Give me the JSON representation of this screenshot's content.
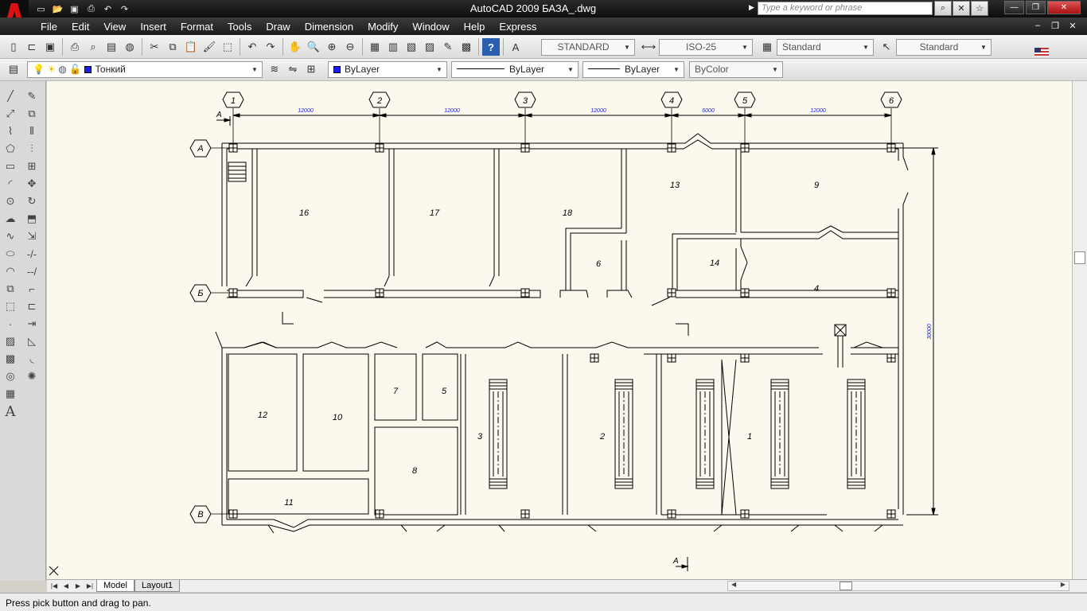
{
  "app": {
    "logo_letter": "A",
    "title": "AutoCAD 2009 БАЗА_.dwg",
    "search_placeholder": "Type a keyword or phrase"
  },
  "menu": [
    "File",
    "Edit",
    "View",
    "Insert",
    "Format",
    "Tools",
    "Draw",
    "Dimension",
    "Modify",
    "Window",
    "Help",
    "Express"
  ],
  "toolbar": {
    "text_style": "STANDARD",
    "dim_style": "ISO-25",
    "table_style": "Standard",
    "multileader_style": "Standard",
    "layer": "Тонкий",
    "color": "ByLayer",
    "linetype": "ByLayer",
    "lineweight": "ByLayer",
    "plot_style": "ByColor"
  },
  "drawing": {
    "axes_columns": [
      "1",
      "2",
      "3",
      "4",
      "5",
      "6"
    ],
    "axes_rows": [
      "А",
      "Б",
      "В"
    ],
    "dims_top": [
      "12000",
      "12000",
      "12000",
      "6000",
      "12000"
    ],
    "dim_right": "30000",
    "section_mark": "А",
    "rooms": [
      "16",
      "17",
      "18",
      "13",
      "9",
      "6",
      "14",
      "4",
      "12",
      "10",
      "7",
      "5",
      "3",
      "2",
      "1",
      "8",
      "11"
    ]
  },
  "tabs": [
    "Model",
    "Layout1"
  ],
  "status": {
    "message": "Press pick button and drag to pan."
  },
  "colors": {
    "canvas": "#fbf9ee",
    "ink": "#000000",
    "dimension_text": "#1a1aff",
    "layer_swatch": "#1a1aff"
  }
}
